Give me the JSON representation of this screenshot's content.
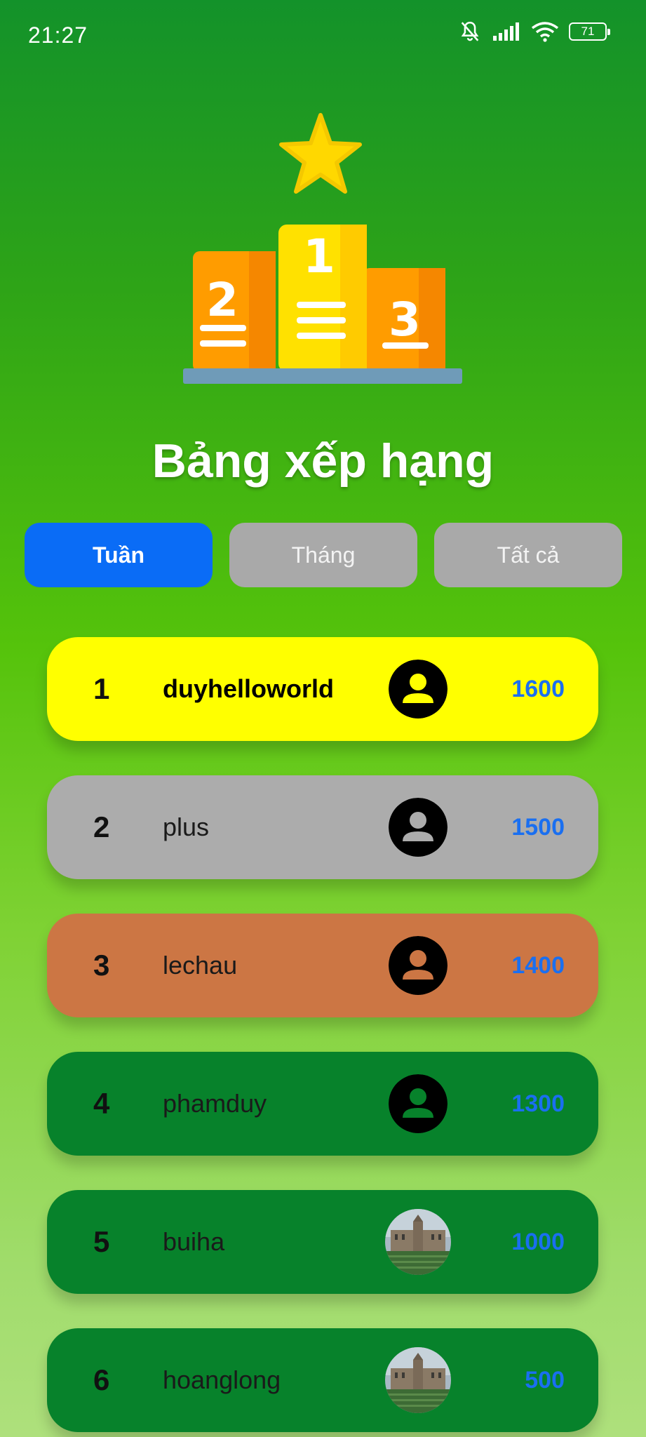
{
  "status_bar": {
    "time": "21:27",
    "battery": "71"
  },
  "header": {
    "title": "Bảng xếp hạng"
  },
  "podium": {
    "first": "1",
    "second": "2",
    "third": "3"
  },
  "tabs": [
    {
      "label": "Tuần",
      "active": true
    },
    {
      "label": "Tháng",
      "active": false
    },
    {
      "label": "Tất cả",
      "active": false
    }
  ],
  "leaderboard": [
    {
      "rank": "1",
      "name": "duyhelloworld",
      "score": "1600",
      "bg": "#ffff00",
      "avatar": "default-user-icon"
    },
    {
      "rank": "2",
      "name": "plus",
      "score": "1500",
      "bg": "#acacac",
      "avatar": "default-user-icon"
    },
    {
      "rank": "3",
      "name": "lechau",
      "score": "1400",
      "bg": "#cc7644",
      "avatar": "default-user-icon"
    },
    {
      "rank": "4",
      "name": "phamduy",
      "score": "1300",
      "bg": "#07822b",
      "avatar": "default-user-icon"
    },
    {
      "rank": "5",
      "name": "buiha",
      "score": "1000",
      "bg": "#07822b",
      "avatar": "building-photo"
    },
    {
      "rank": "6",
      "name": "hoanglong",
      "score": "500",
      "bg": "#07822b",
      "avatar": "building-photo"
    }
  ]
}
